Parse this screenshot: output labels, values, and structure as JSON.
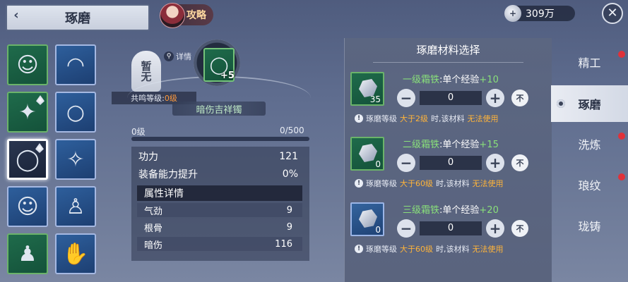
{
  "header": {
    "title": "琢磨",
    "guide_label": "攻略",
    "currency": "309万"
  },
  "item_grid": [
    {
      "icon": "character-portrait-icon",
      "color": "green"
    },
    {
      "icon": "fan-icon",
      "color": "blue"
    },
    {
      "icon": "pendant-icon",
      "color": "green"
    },
    {
      "icon": "ring-icon",
      "color": "blue"
    },
    {
      "icon": "bracelet-icon",
      "color": "green",
      "selected": true
    },
    {
      "icon": "wand-pendant-icon",
      "color": "blue"
    },
    {
      "icon": "character-portrait-icon",
      "color": "blue"
    },
    {
      "icon": "robe-icon",
      "color": "blue"
    },
    {
      "icon": "dark-robe-icon",
      "color": "green"
    },
    {
      "icon": "gauntlet-icon",
      "color": "blue"
    }
  ],
  "seal": {
    "text": "暂无",
    "detail_label": "详情"
  },
  "resonance": {
    "label": "共鸣等级:",
    "level": "0级"
  },
  "equipped": {
    "plus": "+5",
    "name": "暗伤吉祥镯"
  },
  "progress": {
    "level": "0级",
    "value": "0/500",
    "fraction": 0
  },
  "stats": {
    "power_label": "功力",
    "power_value": "121",
    "boost_label": "装备能力提升",
    "boost_value": "0%",
    "attr_header": "属性详情",
    "attrs": [
      {
        "name": "气劲",
        "value": "9"
      },
      {
        "name": "根骨",
        "value": "9"
      },
      {
        "name": "暗伤",
        "value": "116"
      }
    ]
  },
  "materials": {
    "title": "琢磨材料选择",
    "items": [
      {
        "tier": "一级霜铁",
        "desc": ":单个经验",
        "exp": "+10",
        "count": "35",
        "qty": "0",
        "frame": "green",
        "hint_pre": "琢磨等级",
        "hint_hl": "大于2级",
        "hint_mid": "时,该材料",
        "hint_end": "无法使用"
      },
      {
        "tier": "二级霜铁",
        "desc": ":单个经验",
        "exp": "+15",
        "count": "0",
        "qty": "0",
        "frame": "green",
        "hint_pre": "琢磨等级",
        "hint_hl": "大于60级",
        "hint_mid": "时,该材料",
        "hint_end": "无法使用"
      },
      {
        "tier": "三级霜铁",
        "desc": ":单个经验",
        "exp": "+20",
        "count": "0",
        "qty": "0",
        "frame": "blue",
        "hint_pre": "琢磨等级",
        "hint_hl": "大于60级",
        "hint_mid": "时,该材料",
        "hint_end": "无法使用"
      }
    ],
    "minus": "−",
    "plus": "+",
    "no_label": "不"
  },
  "tabs": [
    {
      "label": "精工",
      "active": false,
      "dot": true
    },
    {
      "label": "琢磨",
      "active": true,
      "dot": false
    },
    {
      "label": "洗炼",
      "active": false,
      "dot": true
    },
    {
      "label": "琅纹",
      "active": false,
      "dot": true
    },
    {
      "label": "珑铸",
      "active": false,
      "dot": false
    }
  ]
}
